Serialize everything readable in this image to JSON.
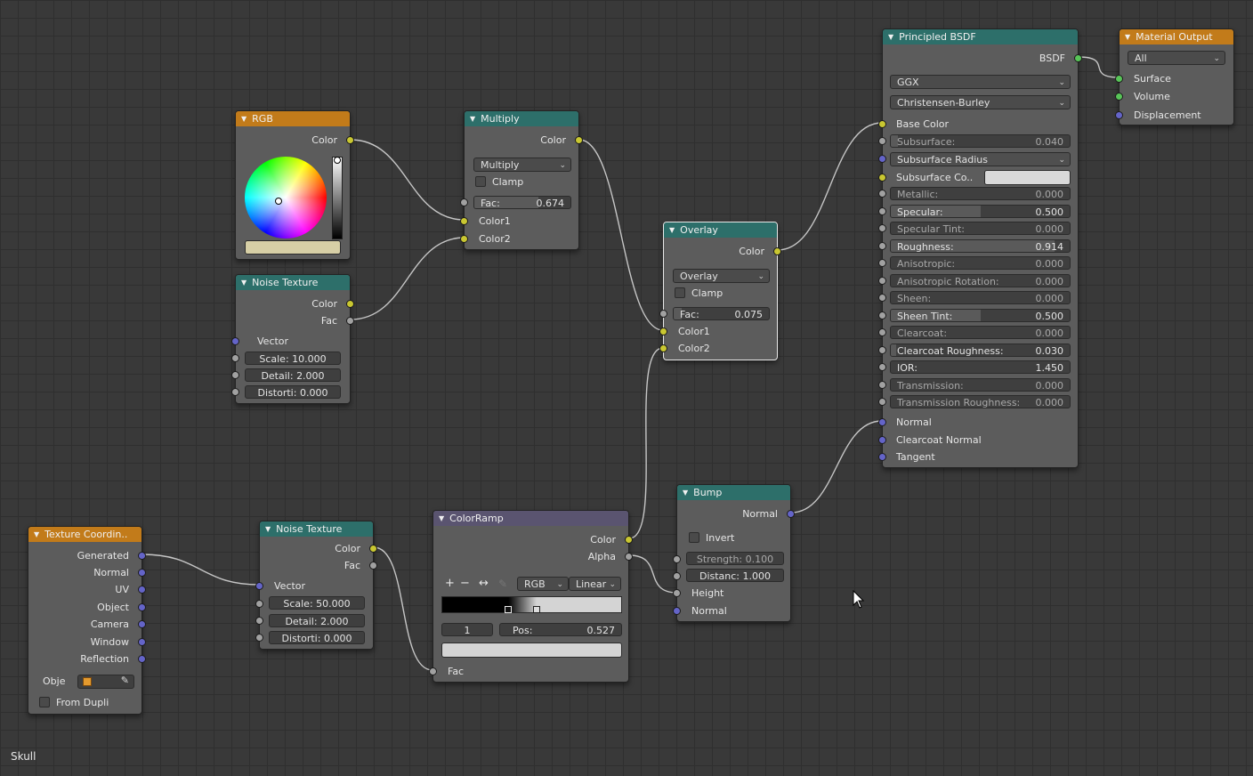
{
  "editor": {
    "material_name": "Skull",
    "background_color": "#393939",
    "grid_color": "#2f2f2f"
  },
  "socket_colors": {
    "color": "#c9c731",
    "float": "#a1a1a1",
    "vector": "#6464c8",
    "shader": "#58c458"
  },
  "nodes": {
    "rgb": {
      "title": "RGB",
      "output_color": "Color",
      "swatch_color": "#d7cfa6"
    },
    "noise_top": {
      "title": "Noise Texture",
      "outputs": [
        "Color",
        "Fac"
      ],
      "vector": "Vector",
      "scale": {
        "label": "Scale:",
        "value": "10.000"
      },
      "detail": {
        "label": "Detail:",
        "value": "2.000"
      },
      "distortion": {
        "label": "Distorti:",
        "value": "0.000"
      }
    },
    "multiply": {
      "title": "Multiply",
      "output": "Color",
      "blend_mode": "Multiply",
      "clamp": "Clamp",
      "fac": {
        "label": "Fac:",
        "value": "0.674"
      },
      "inputs": [
        "Color1",
        "Color2"
      ]
    },
    "overlay": {
      "title": "Overlay",
      "output": "Color",
      "blend_mode": "Overlay",
      "clamp": "Clamp",
      "fac": {
        "label": "Fac:",
        "value": "0.075"
      },
      "inputs": [
        "Color1",
        "Color2"
      ]
    },
    "principled": {
      "title": "Principled BSDF",
      "output": "BSDF",
      "distribution": "GGX",
      "subsurface_method": "Christensen-Burley",
      "base_color": "Base Color",
      "subsurface": {
        "label": "Subsurface:",
        "value": "0.040",
        "fill": 0.04
      },
      "subsurface_radius": "Subsurface Radius",
      "subsurface_color": "Subsurface Co..",
      "subsurface_color_swatch": "#d9d9d9",
      "params": [
        {
          "label": "Metallic:",
          "value": "0.000",
          "fill": 0.0
        },
        {
          "label": "Specular:",
          "value": "0.500",
          "fill": 0.5
        },
        {
          "label": "Specular Tint:",
          "value": "0.000",
          "fill": 0.0
        },
        {
          "label": "Roughness:",
          "value": "0.914",
          "fill": 0.914
        },
        {
          "label": "Anisotropic:",
          "value": "0.000",
          "fill": 0.0
        },
        {
          "label": "Anisotropic Rotation:",
          "value": "0.000",
          "fill": 0.0
        },
        {
          "label": "Sheen:",
          "value": "0.000",
          "fill": 0.0
        },
        {
          "label": "Sheen Tint:",
          "value": "0.500",
          "fill": 0.5
        },
        {
          "label": "Clearcoat:",
          "value": "0.000",
          "fill": 0.0
        },
        {
          "label": "Clearcoat Roughness:",
          "value": "0.030",
          "fill": 0.03
        },
        {
          "label": "IOR:",
          "value": "1.450",
          "fill": 0.0
        },
        {
          "label": "Transmission:",
          "value": "0.000",
          "fill": 0.0
        },
        {
          "label": "Transmission Roughness:",
          "value": "0.000",
          "fill": 0.0
        }
      ],
      "normal": "Normal",
      "clearcoat_normal": "Clearcoat Normal",
      "tangent": "Tangent"
    },
    "material_output": {
      "title": "Material Output",
      "target": "All",
      "inputs": [
        "Surface",
        "Volume",
        "Displacement"
      ]
    },
    "texcoord": {
      "title": "Texture Coordin..",
      "outputs": [
        "Generated",
        "Normal",
        "UV",
        "Object",
        "Camera",
        "Window",
        "Reflection"
      ],
      "object_label": "Obje",
      "from_dupli": "From Dupli"
    },
    "noise_bottom": {
      "title": "Noise Texture",
      "outputs": [
        "Color",
        "Fac"
      ],
      "vector": "Vector",
      "scale": {
        "label": "Scale:",
        "value": "50.000"
      },
      "detail": {
        "label": "Detail:",
        "value": "2.000"
      },
      "distortion": {
        "label": "Distorti:",
        "value": "0.000"
      }
    },
    "colorramp": {
      "title": "ColorRamp",
      "outputs": [
        "Color",
        "Alpha"
      ],
      "add": "+",
      "remove": "−",
      "flip": "↔",
      "color_mode": "RGB",
      "interpolation": "Linear",
      "stop_index": "1",
      "pos": {
        "label": "Pos:",
        "value": "0.527"
      },
      "stops": [
        0.37,
        0.527
      ],
      "stop_color_swatch": "#d4d4d4",
      "input": "Fac"
    },
    "bump": {
      "title": "Bump",
      "output": "Normal",
      "invert": "Invert",
      "strength": {
        "label": "Strength:",
        "value": "0.100"
      },
      "distance": {
        "label": "Distanc:",
        "value": "1.000"
      },
      "height": "Height",
      "normal": "Normal"
    }
  }
}
